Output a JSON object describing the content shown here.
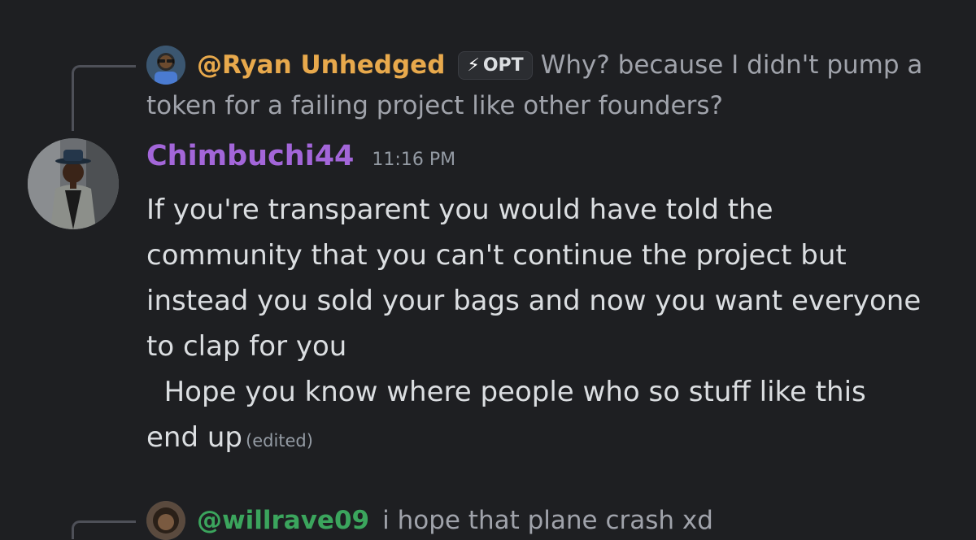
{
  "reply_top": {
    "username": "@Ryan Unhedged",
    "username_color": "#e8a94c",
    "badge": {
      "icon": "lightning-bolt-icon",
      "label": "OPT"
    },
    "text_line1": "Why? because I didn't pump a",
    "text_line2": "token for a failing project like other founders?"
  },
  "message": {
    "author": "Chimbuchi44",
    "author_color": "#a366d9",
    "timestamp": "11:16 PM",
    "lines": [
      "If you're transparent you would have told the",
      "community that you can't continue the project but",
      "instead you sold your bags and now you want everyone",
      "to clap for you",
      "  Hope you know where people who so stuff like this",
      "end up"
    ],
    "edited_label": "(edited)"
  },
  "reply_bottom": {
    "username": "@willrave09",
    "username_color": "#3ba55d",
    "text": "i hope that plane crash xd"
  }
}
